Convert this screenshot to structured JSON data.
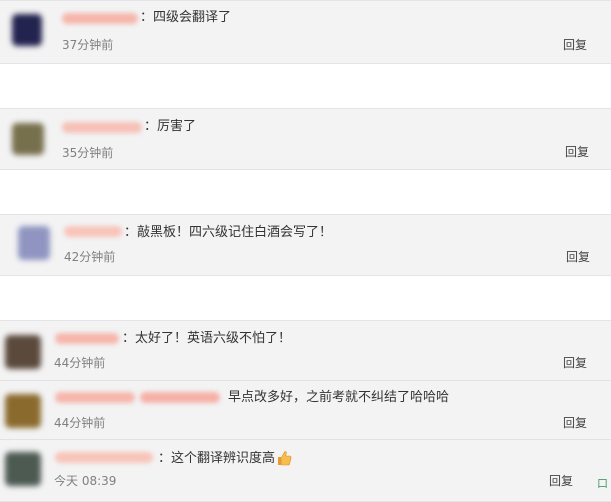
{
  "comments": [
    {
      "text": "：四级会翻译了",
      "time": "37分钟前",
      "reply": "回复"
    },
    {
      "text": "：厉害了",
      "time": "35分钟前",
      "reply": "回复"
    },
    {
      "text": "：敲黑板！四六级记住白酒会写了！",
      "time": "42分钟前",
      "reply": "回复"
    },
    {
      "text": "：太好了！英语六级不怕了！",
      "time": "44分钟前",
      "reply": "回复"
    },
    {
      "text": "早点改多好，之前考就不纠结了哈哈哈",
      "time": "44分钟前",
      "reply": "回复"
    },
    {
      "text": "：这个翻译辨识度高",
      "time": "今天 08:39",
      "reply": "回复",
      "emoji": "thumbs-up-icon"
    }
  ],
  "edge_fragment": "口",
  "colors": {
    "card_bg": "#f3f3f4",
    "name_blur": "#f6b6ab",
    "text": "#333333",
    "time": "#808080"
  }
}
